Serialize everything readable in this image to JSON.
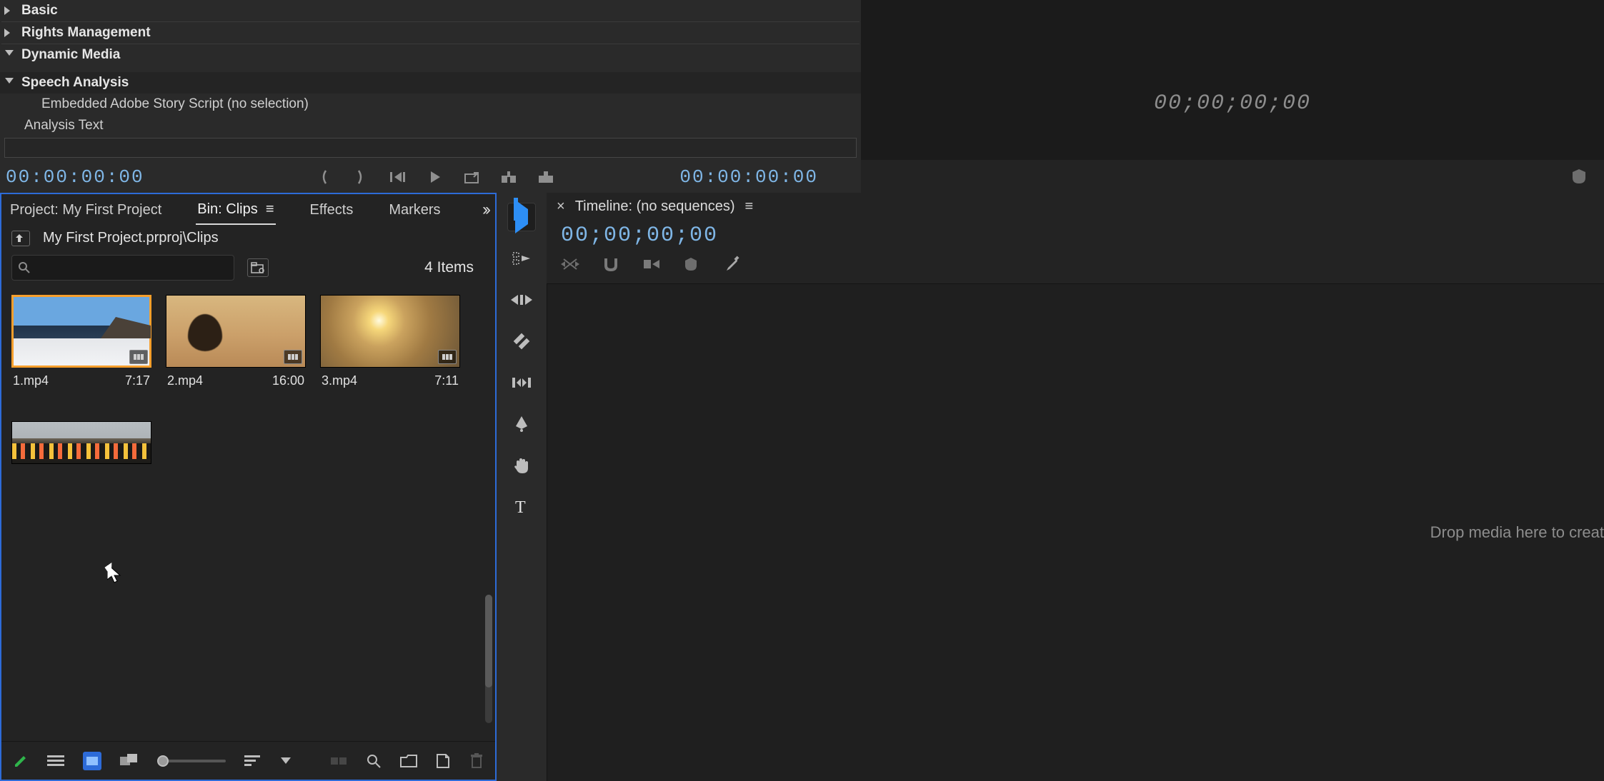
{
  "metadata": {
    "rows": [
      {
        "label": "Basic",
        "expanded": false
      },
      {
        "label": "Rights Management",
        "expanded": false
      },
      {
        "label": "Dynamic Media",
        "expanded": true
      }
    ],
    "speech_header": "Speech Analysis",
    "embedded_script": "Embedded Adobe Story Script (no selection)",
    "analysis_text_label": "Analysis Text"
  },
  "source_monitor": {
    "tc_in": "00:00:00:00",
    "tc_out": "00:00:00:00"
  },
  "program_monitor": {
    "tc": "00;00;00;00"
  },
  "project": {
    "tabs": {
      "project": "Project: My First Project",
      "bin": "Bin: Clips",
      "effects": "Effects",
      "markers": "Markers"
    },
    "breadcrumb": "My First Project.prproj\\Clips",
    "item_count": "4 Items",
    "clips": [
      {
        "name": "1.mp4",
        "duration": "7:17"
      },
      {
        "name": "2.mp4",
        "duration": "16:00"
      },
      {
        "name": "3.mp4",
        "duration": "7:11"
      },
      {
        "name": "",
        "duration": ""
      }
    ]
  },
  "timeline": {
    "title": "Timeline: (no sequences)",
    "tc": "00;00;00;00",
    "drop_hint": "Drop media here to creat"
  }
}
